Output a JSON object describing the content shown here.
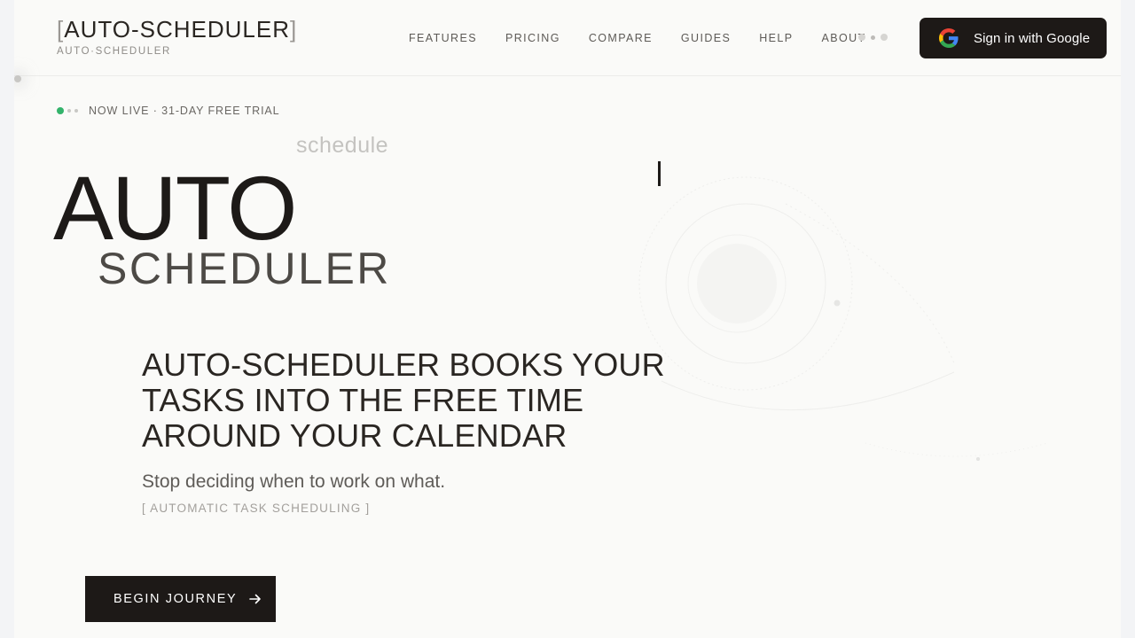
{
  "header": {
    "brand_bracket_open": "[",
    "brand_name": "AUTO-SCHEDULER",
    "brand_bracket_close": "]",
    "brand_sub": "AUTO·SCHEDULER",
    "nav": [
      "FEATURES",
      "PRICING",
      "COMPARE",
      "GUIDES",
      "HELP",
      "ABOUT"
    ],
    "signin_label": "Sign in with Google"
  },
  "hero": {
    "status_text": "NOW LIVE · 31-DAY FREE TRIAL",
    "floating_word": "schedule",
    "title_line1": "AUTO",
    "title_line2": "SCHEDULER",
    "headline": "AUTO-SCHEDULER BOOKS YOUR TASKS INTO THE FREE TIME AROUND YOUR CALENDAR",
    "subheadline": "Stop deciding when to work on what.",
    "tagline": "[ AUTOMATIC TASK SCHEDULING ]",
    "cta_label": "BEGIN JOURNEY"
  },
  "colors": {
    "accent_dark": "#1d1917",
    "status_green": "#33b36b",
    "background": "#fafaf8"
  }
}
